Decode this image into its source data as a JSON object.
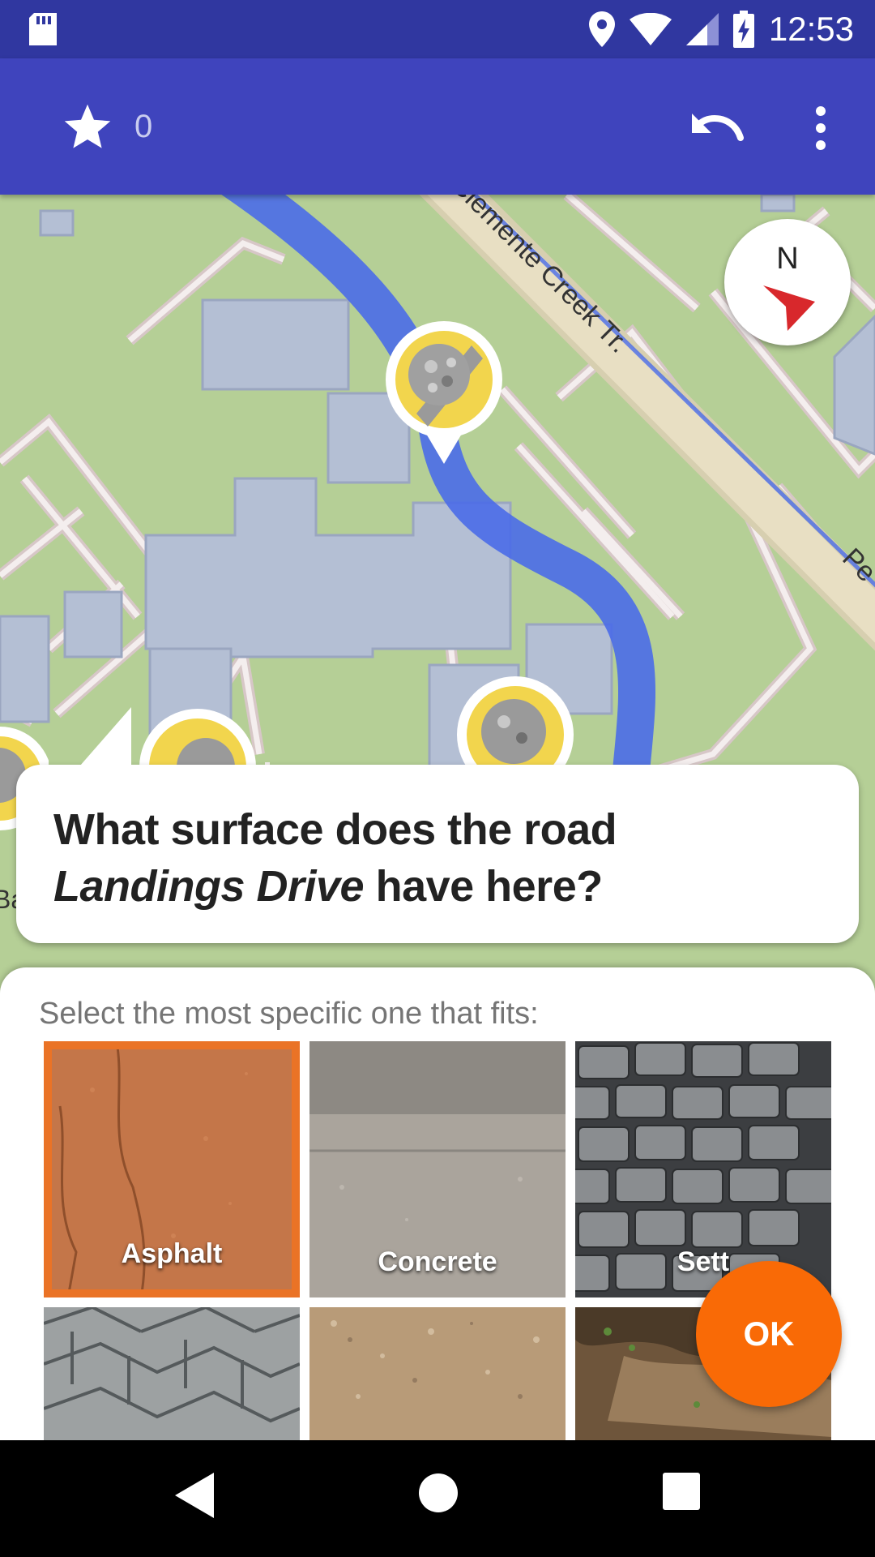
{
  "status_bar": {
    "time": "12:53"
  },
  "app_bar": {
    "star_count": "0"
  },
  "map": {
    "street_labels": [
      "Clemente Creek Tr.",
      "Pe",
      "Ba"
    ],
    "compass_label": "N"
  },
  "question": {
    "line1": "What surface does the road",
    "road_name": "Landings Drive",
    "line2_suffix": " have here?"
  },
  "answers": {
    "hint": "Select the most specific one that fits:",
    "options": [
      {
        "label": "Asphalt",
        "selected": true
      },
      {
        "label": "Concrete",
        "selected": false
      },
      {
        "label": "Sett",
        "selected": false
      },
      {
        "label": "",
        "selected": false
      },
      {
        "label": "",
        "selected": false
      },
      {
        "label": "",
        "selected": false
      }
    ]
  },
  "ok_button": {
    "label": "OK"
  },
  "colors": {
    "app_bar": "#3f44bd",
    "status_bar": "#3037a0",
    "accent": "#f96a06",
    "route": "#4a6be8"
  }
}
